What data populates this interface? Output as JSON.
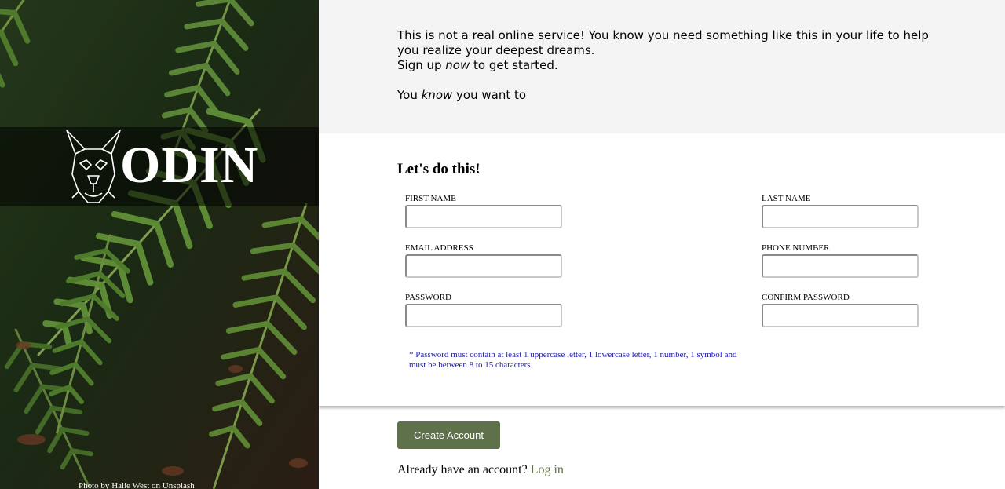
{
  "brand": {
    "name": "ODIN",
    "photo_credit_prefix": "Photo by ",
    "photo_credit_author": "Halie West",
    "photo_credit_middle": " on ",
    "photo_credit_source": "Unsplash"
  },
  "intro": {
    "line1": "This is not a real online service! You know you need something like this in your life to help you realize your deepest dreams.",
    "line2_before": "Sign up ",
    "line2_em": "now",
    "line2_after": " to get started.",
    "line3_before": "You ",
    "line3_em": "know",
    "line3_after": " you want to"
  },
  "form": {
    "title": "Let's do this!",
    "fields": {
      "first_name": {
        "label": "First Name",
        "value": ""
      },
      "last_name": {
        "label": "Last Name",
        "value": ""
      },
      "email": {
        "label": "Email Address",
        "value": ""
      },
      "phone": {
        "label": "Phone Number",
        "value": ""
      },
      "password": {
        "label": "Password",
        "value": ""
      },
      "confirm_password": {
        "label": "Confirm Password",
        "value": ""
      }
    },
    "password_hint": "* Password must contain at least 1 uppercase letter, 1 lowercase letter, 1 number, 1 symbol and must be between 8 to 15 characters"
  },
  "actions": {
    "create_label": "Create Account",
    "login_prompt": "Already have an account? ",
    "login_label": "Log in"
  },
  "colors": {
    "accent": "#5e714a",
    "intro_bg": "#f4f4f4",
    "hint": "#1a1ab0"
  },
  "icons": {
    "logo": "dog-head-icon"
  }
}
